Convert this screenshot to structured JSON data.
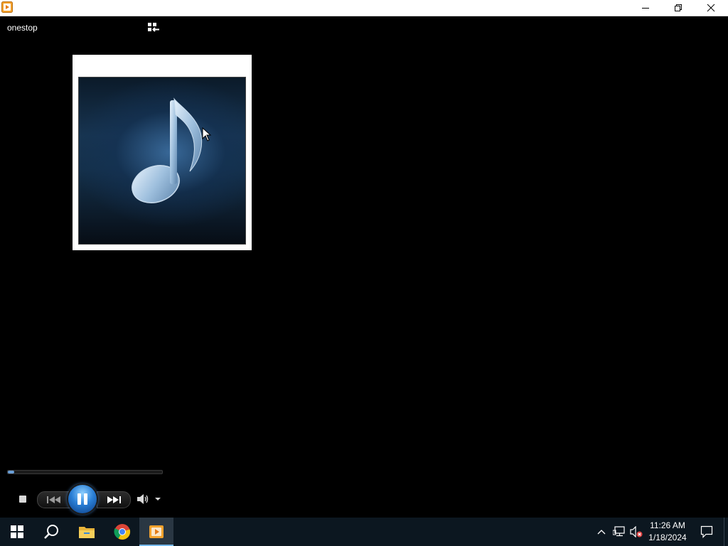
{
  "window": {
    "app_icon": "media-player-icon",
    "controls": [
      "minimize-icon",
      "restore-icon",
      "close-icon"
    ]
  },
  "player": {
    "title": "onestop",
    "switch_view_icon": "switch-to-library-icon",
    "album_art_icon": "music-note-icon",
    "seek_progress": 0.04,
    "controls": {
      "stop": "stop-icon",
      "previous": "previous-icon",
      "play_pause": "pause-icon",
      "next": "next-icon",
      "volume": "speaker-icon",
      "volume_dropdown": "chevron-down-icon"
    }
  },
  "taskbar": {
    "items": [
      "windows-start-icon",
      "search-icon",
      "file-explorer-icon",
      "chrome-icon",
      "media-player-icon"
    ],
    "tray": [
      "chevron-up-icon",
      "network-icon",
      "volume-muted-icon"
    ],
    "clock": {
      "time": "11:26 AM",
      "date": "1/18/2024"
    },
    "notification_icon": "action-center-icon"
  },
  "colors": {
    "accent": "#76b9ed",
    "taskbar_bg": "#0c1720",
    "play_button": "#2a7fd6"
  }
}
